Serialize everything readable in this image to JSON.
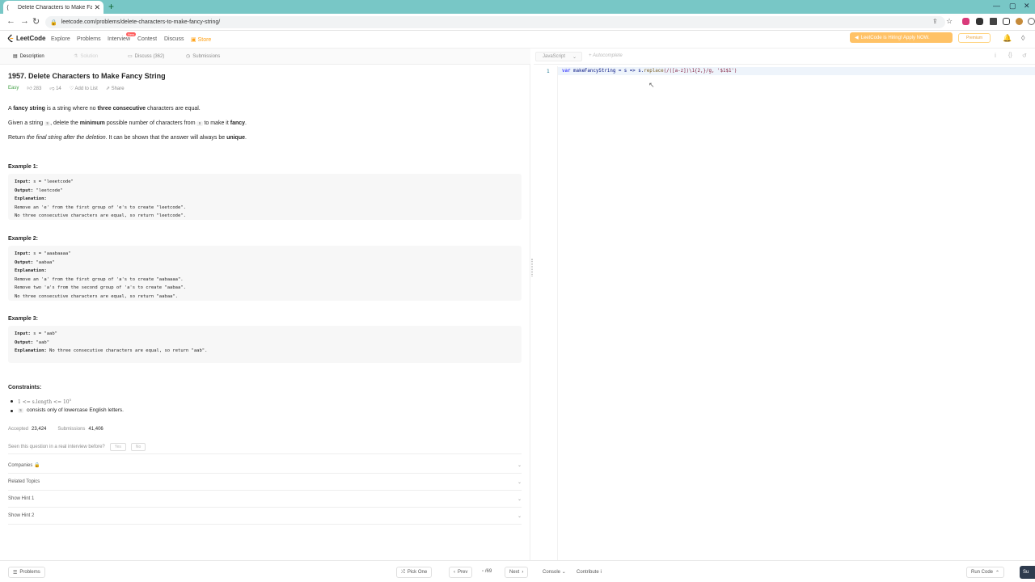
{
  "browser": {
    "tab_title": "Delete Characters to Make Fancy",
    "url": "leetcode.com/problems/delete-characters-to-make-fancy-string/"
  },
  "nav": {
    "logo": "LeetCode",
    "links": [
      "Explore",
      "Problems",
      "Interview",
      "Contest",
      "Discuss",
      "Store"
    ],
    "new_badge": "New",
    "promo": "LeetCode is Hiring! Apply NOW.",
    "premium": "Premium"
  },
  "tabs": {
    "description": "Description",
    "solution": "Solution",
    "discuss": "Discuss (362)",
    "submissions": "Submissions"
  },
  "problem": {
    "title": "1957. Delete Characters to Make Fancy String",
    "difficulty": "Easy",
    "likes": "283",
    "dislikes": "14",
    "add_to_list": "Add to List",
    "share": "Share",
    "p1_a": "A ",
    "p1_b": "fancy string",
    "p1_c": " is a string where no ",
    "p1_d": "three consecutive",
    "p1_e": " characters are equal.",
    "p2_a": "Given a string ",
    "p2_code": "s",
    "p2_b": ", delete the ",
    "p2_c": "minimum",
    "p2_d": " possible number of characters from ",
    "p2_code2": "s",
    "p2_e": " to make it ",
    "p2_f": "fancy",
    "p2_g": ".",
    "p3_a": "Return ",
    "p3_b": "the final string after the deletion",
    "p3_c": ". It can be shown that the answer will always be ",
    "p3_d": "unique",
    "p3_e": "."
  },
  "examples": [
    {
      "heading": "Example 1:",
      "input": " s = \"leeetcode\"",
      "output": " \"leetcode\"",
      "explanation_lines": [
        "Remove an 'e' from the first group of 'e's to create \"leetcode\".",
        "No three consecutive characters are equal, so return \"leetcode\"."
      ]
    },
    {
      "heading": "Example 2:",
      "input": " s = \"aaabaaaa\"",
      "output": " \"aabaa\"",
      "explanation_lines": [
        "Remove an 'a' from the first group of 'a's to create \"aabaaaa\".",
        "Remove two 'a's from the second group of 'a's to create \"aabaa\".",
        "No three consecutive characters are equal, so return \"aabaa\"."
      ]
    },
    {
      "heading": "Example 3:",
      "input": " s = \"aab\"",
      "output": " \"aab\"",
      "explanation_inline": " No three consecutive characters are equal, so return \"aab\"."
    }
  ],
  "labels": {
    "input": "Input:",
    "output": "Output:",
    "explanation": "Explanation:"
  },
  "constraints": {
    "heading": "Constraints:",
    "c1": "1 <= s.length <= 10",
    "c1_sup": "5",
    "c2_code": "s",
    "c2_text": "consists only of lowercase English letters."
  },
  "stats": {
    "accepted_label": "Accepted",
    "accepted": "23,424",
    "submissions_label": "Submissions",
    "submissions": "41,406"
  },
  "seen": {
    "question": "Seen this question in a real interview before?",
    "yes": "Yes",
    "no": "No"
  },
  "accordions": [
    "Companies",
    "Related Topics",
    "Show Hint 1",
    "Show Hint 2"
  ],
  "editor": {
    "language": "JavaScript",
    "autocomplete": "Autocomplete",
    "line_number": "1",
    "code": {
      "kw": "var",
      "name": " makeFancyString",
      "mid": " = s => s.",
      "fn": "replace",
      "regex": "(/([a-z])\\1{2,}/g, '$1$1')"
    }
  },
  "bottom": {
    "problems": "Problems",
    "pick_one": "Pick One",
    "prev": "Prev",
    "page": "/69",
    "next": "Next",
    "console": "Console",
    "contribute": "Contribute",
    "run_code": "Run Code",
    "submit": "Su"
  },
  "colors": {
    "accent": "#ffa116",
    "easy": "#43a047",
    "tabstrip": "#78c7c6"
  }
}
